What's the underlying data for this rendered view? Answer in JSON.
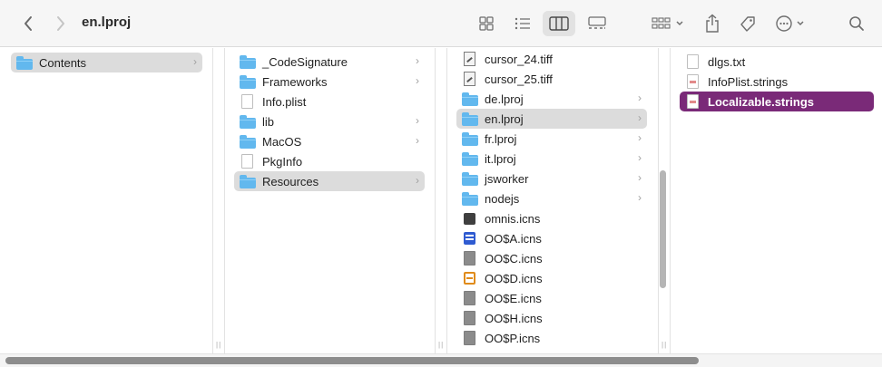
{
  "toolbar": {
    "title": "en.lproj",
    "back_icon": "chevron-left-icon",
    "forward_icon": "chevron-right-icon",
    "views": [
      "icon-view",
      "list-view",
      "column-view",
      "gallery-view"
    ],
    "active_view": "column-view"
  },
  "columns": [
    {
      "items": [
        {
          "label": "Contents",
          "icon": "folder",
          "chevron": true,
          "selected": "gray"
        }
      ]
    },
    {
      "items": [
        {
          "label": "_CodeSignature",
          "icon": "folder",
          "chevron": true
        },
        {
          "label": "Frameworks",
          "icon": "folder",
          "chevron": true
        },
        {
          "label": "Info.plist",
          "icon": "doc",
          "chevron": false
        },
        {
          "label": "lib",
          "icon": "folder",
          "chevron": true
        },
        {
          "label": "MacOS",
          "icon": "folder",
          "chevron": true
        },
        {
          "label": "PkgInfo",
          "icon": "doc",
          "chevron": false
        },
        {
          "label": "Resources",
          "icon": "folder",
          "chevron": true,
          "selected": "gray"
        }
      ]
    },
    {
      "items": [
        {
          "label": "cursor_24.tiff",
          "icon": "tiff",
          "chevron": false
        },
        {
          "label": "cursor_25.tiff",
          "icon": "tiff",
          "chevron": false
        },
        {
          "label": "de.lproj",
          "icon": "folder",
          "chevron": true
        },
        {
          "label": "en.lproj",
          "icon": "folder",
          "chevron": true,
          "selected": "gray"
        },
        {
          "label": "fr.lproj",
          "icon": "folder",
          "chevron": true
        },
        {
          "label": "it.lproj",
          "icon": "folder",
          "chevron": true
        },
        {
          "label": "jsworker",
          "icon": "folder",
          "chevron": true
        },
        {
          "label": "nodejs",
          "icon": "folder",
          "chevron": true
        },
        {
          "label": "omnis.icns",
          "icon": "blk",
          "chevron": false
        },
        {
          "label": "OO$A.icns",
          "icon": "blue-stack",
          "chevron": false
        },
        {
          "label": "OO$C.icns",
          "icon": "doc-dark",
          "chevron": false
        },
        {
          "label": "OO$D.icns",
          "icon": "orange-stack",
          "chevron": false
        },
        {
          "label": "OO$E.icns",
          "icon": "doc-dark",
          "chevron": false
        },
        {
          "label": "OO$H.icns",
          "icon": "doc-dark",
          "chevron": false
        },
        {
          "label": "OO$P.icns",
          "icon": "doc-dark",
          "chevron": false
        }
      ]
    },
    {
      "items": [
        {
          "label": "dlgs.txt",
          "icon": "doc",
          "chevron": false
        },
        {
          "label": "InfoPlist.strings",
          "icon": "doc-pink",
          "chevron": false
        },
        {
          "label": "Localizable.strings",
          "icon": "doc-pink",
          "chevron": false,
          "selected": "purple"
        }
      ]
    }
  ]
}
